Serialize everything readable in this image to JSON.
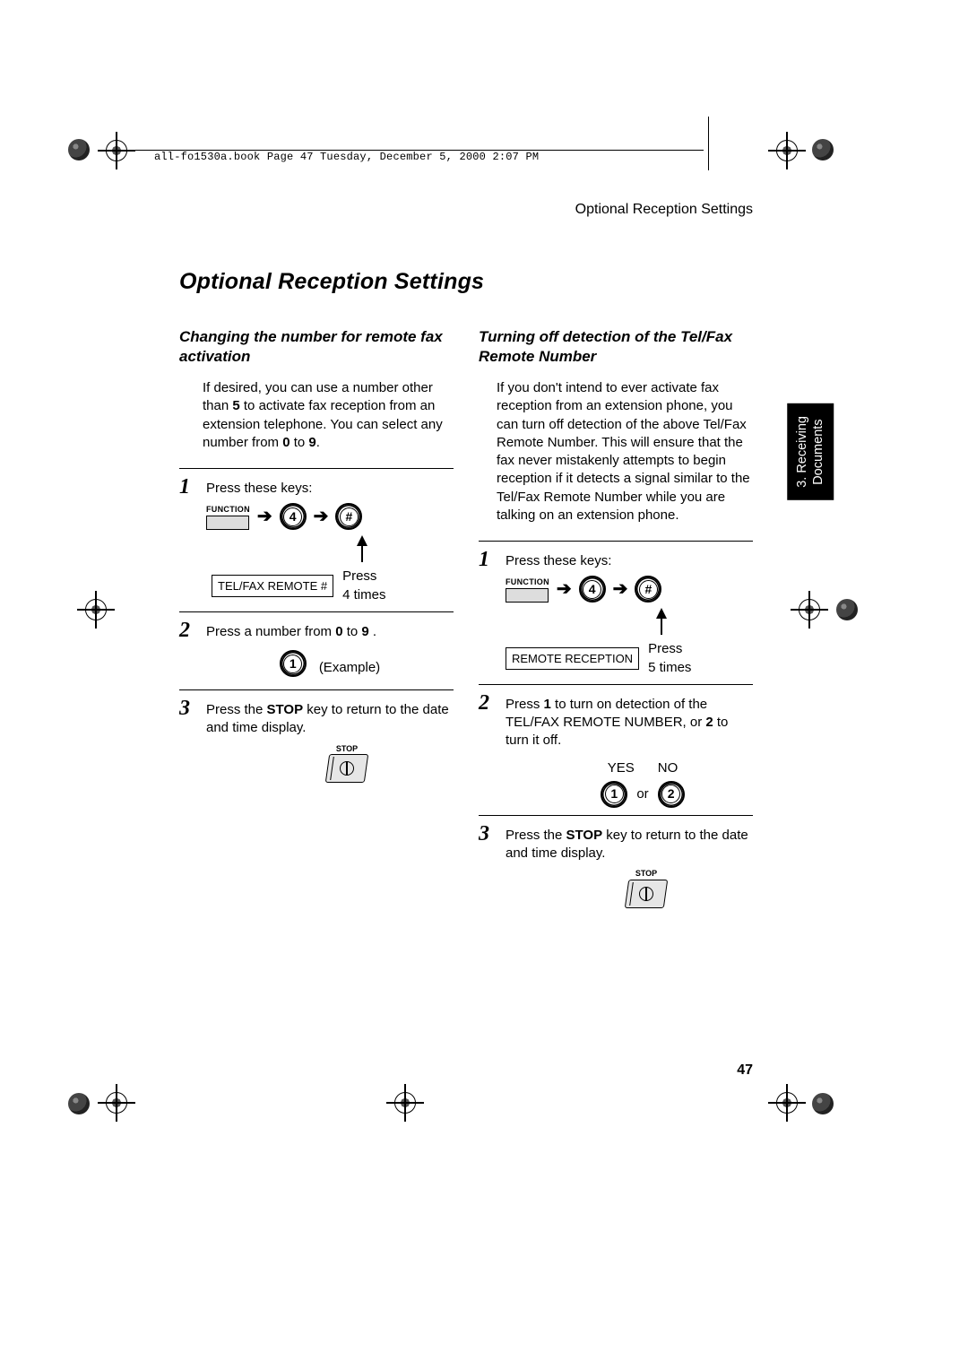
{
  "running_header": "all-fo1530a.book  Page 47  Tuesday, December 5, 2000  2:07 PM",
  "section_header_right": "Optional Reception Settings",
  "page_title": "Optional Reception Settings",
  "side_tab": "3. Receiving\nDocuments",
  "page_number": "47",
  "left": {
    "subhead": "Changing the number for remote fax activation",
    "intro_pre": "If desired, you can use a number other than ",
    "intro_bold1": "5",
    "intro_mid": " to activate fax reception from an extension telephone. You can select any number from ",
    "intro_bold2": "0",
    "intro_to": " to ",
    "intro_bold3": "9",
    "intro_end": ".",
    "step1_num": "1",
    "step1_text": "Press these keys:",
    "func_label": "FUNCTION",
    "key4": "4",
    "display_box": "TEL/FAX REMOTE #",
    "press_times_a": "Press",
    "press_times_b": "4 times",
    "step2_num": "2",
    "step2_pre": "Press a number from ",
    "step2_b1": "0",
    "step2_to": " to ",
    "step2_b2": "9",
    "step2_end": " .",
    "example_key": "1",
    "example_label": "(Example)",
    "step3_num": "3",
    "step3_pre": "Press the ",
    "step3_bold": "STOP",
    "step3_post": " key to return to the date and time display.",
    "stop_label": "STOP"
  },
  "right": {
    "subhead": "Turning off detection of the Tel/Fax Remote Number",
    "intro": "If you don't intend to ever activate fax reception from an extension phone, you can turn off detection of the above Tel/Fax Remote Number. This will ensure that the fax never mistakenly attempts to begin reception if it detects a signal similar to the Tel/Fax Remote Number while you are talking on an extension phone.",
    "step1_num": "1",
    "step1_text": "Press these keys:",
    "func_label": "FUNCTION",
    "key4": "4",
    "display_box": "REMOTE RECEPTION",
    "press_times_a": "Press",
    "press_times_b": "5 times",
    "step2_num": "2",
    "step2_pre": "Press ",
    "step2_b1": "1",
    "step2_mid": " to turn on detection of the TEL/FAX REMOTE NUMBER, or ",
    "step2_b2": "2",
    "step2_post": " to turn it off.",
    "yes": "YES",
    "no": "NO",
    "key1": "1",
    "or": "or",
    "key2": "2",
    "step3_num": "3",
    "step3_pre": "Press the ",
    "step3_bold": "STOP",
    "step3_post": " key to return to the date and time display.",
    "stop_label": "STOP"
  }
}
